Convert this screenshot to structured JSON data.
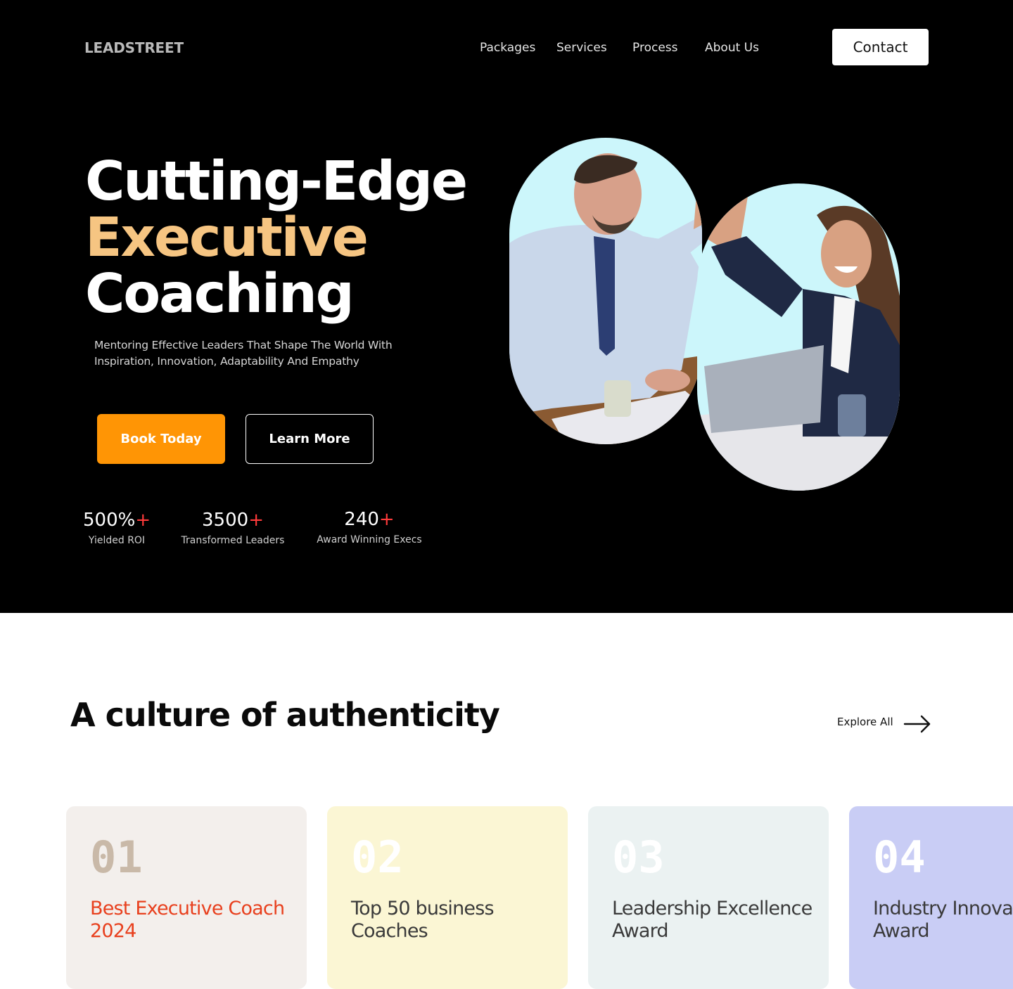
{
  "brand": "LEADSTREET",
  "nav": {
    "items": [
      "Packages",
      "Services",
      "Process",
      "About Us"
    ],
    "contact_label": "Contact"
  },
  "hero": {
    "title_line1": "Cutting-Edge",
    "title_line2": "Executive",
    "title_line3": "Coaching",
    "subtitle": "Mentoring Effective Leaders That  Shape The World With\nInspiration, Innovation,  Adaptability And Empathy",
    "cta_primary": "Book Today",
    "cta_secondary": "Learn More",
    "stats": [
      {
        "value": "500%",
        "plus": "+",
        "label": "Yielded ROI"
      },
      {
        "value": "3500",
        "plus": "+",
        "label": "Transformed Leaders"
      },
      {
        "value": "240",
        "plus": "+",
        "label": "Award Winning Execs"
      }
    ]
  },
  "awards": {
    "title": "A culture of authenticity",
    "explore_label": "Explore All",
    "cards": [
      {
        "num": "01",
        "title": "Best Executive Coach 2024"
      },
      {
        "num": "02",
        "title": "Top 50 business Coaches"
      },
      {
        "num": "03",
        "title": "Leadership Excellence Award"
      },
      {
        "num": "04",
        "title": "Industry Innovation Award"
      }
    ]
  },
  "colors": {
    "accent_orange": "#ff9505",
    "headline_accent": "#f6c582",
    "plus_red": "#ff3b3b",
    "card1_bg": "#f3efec",
    "card2_bg": "#fbf6d4",
    "card3_bg": "#ebf2f2",
    "card4_bg": "#c9cdf5"
  },
  "icons": {
    "explore": "arrow-right-icon"
  }
}
